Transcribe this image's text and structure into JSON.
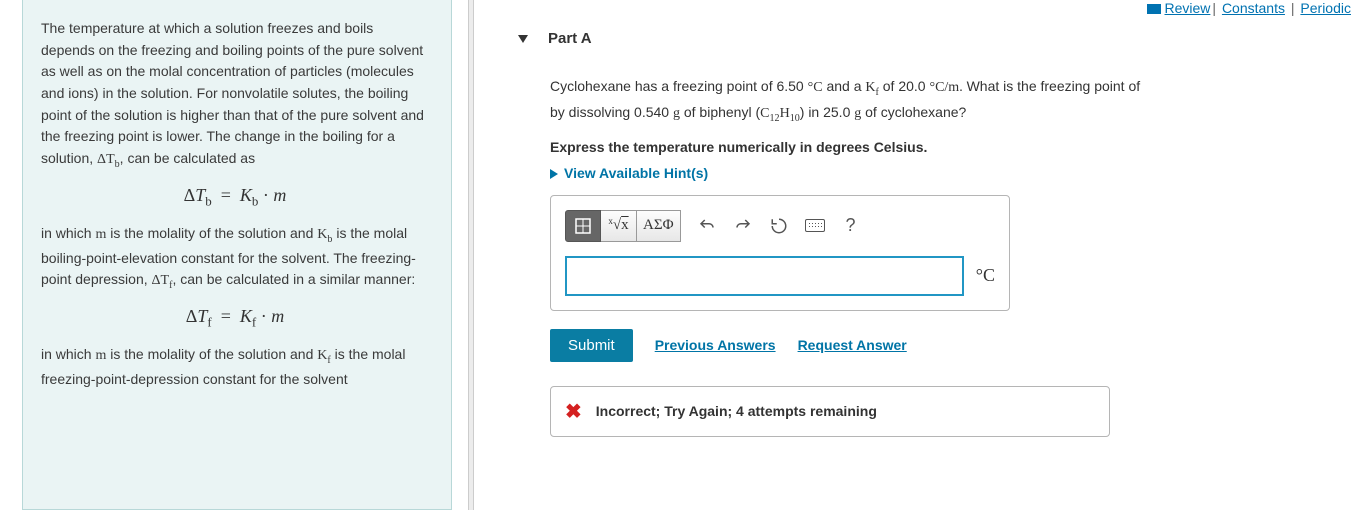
{
  "top_links": {
    "review": "Review",
    "constants": "Constants",
    "periodic": "Periodic"
  },
  "left_panel": {
    "paragraph1_a": "The temperature at which a solution freezes and boils depends on the freezing and boiling points of the pure solvent as well as on the molal concentration of particles (molecules and ions) in the solution. For nonvolatile solutes, the boiling point of the solution is higher than that of the pure solvent and the freezing point is lower. The change in the boiling for a solution, ",
    "paragraph1_b": ", can be calculated as",
    "equation1": "ΔTb = Kb · m",
    "paragraph2_a": "in which ",
    "paragraph2_b": " is the molality of the solution and ",
    "paragraph2_c": " is the molal boiling-point-elevation constant for the solvent. The freezing-point depression, ",
    "paragraph2_d": ", can be calculated in a similar manner:",
    "equation2": "ΔTf = Kf · m",
    "paragraph3_a": "in which ",
    "paragraph3_b": " is the molality of the solution and ",
    "paragraph3_c": " is the molal freezing-point-depression constant for the solvent"
  },
  "part": {
    "label": "Part A",
    "question_a": "Cyclohexane has a freezing point of 6.50 ",
    "question_b": " and a ",
    "question_c": " of 20.0 ",
    "question_d": " What is the freezing point of",
    "question_e": " by dissolving 0.540 ",
    "question_f": " of biphenyl (",
    "question_g": ") in 25.0 ",
    "question_h": " of cyclohexane?",
    "instruction": "Express the temperature numerically in degrees Celsius.",
    "hints_label": "View Available Hint(s)",
    "toolbar": {
      "templates": "⎯",
      "sqrt": "x√x̄",
      "greek": "ΑΣΦ",
      "help": "?"
    },
    "unit_label": "°C",
    "answer_value": "",
    "submit": "Submit",
    "previous": "Previous Answers",
    "request": "Request Answer",
    "feedback": "Incorrect; Try Again; 4 attempts remaining"
  }
}
